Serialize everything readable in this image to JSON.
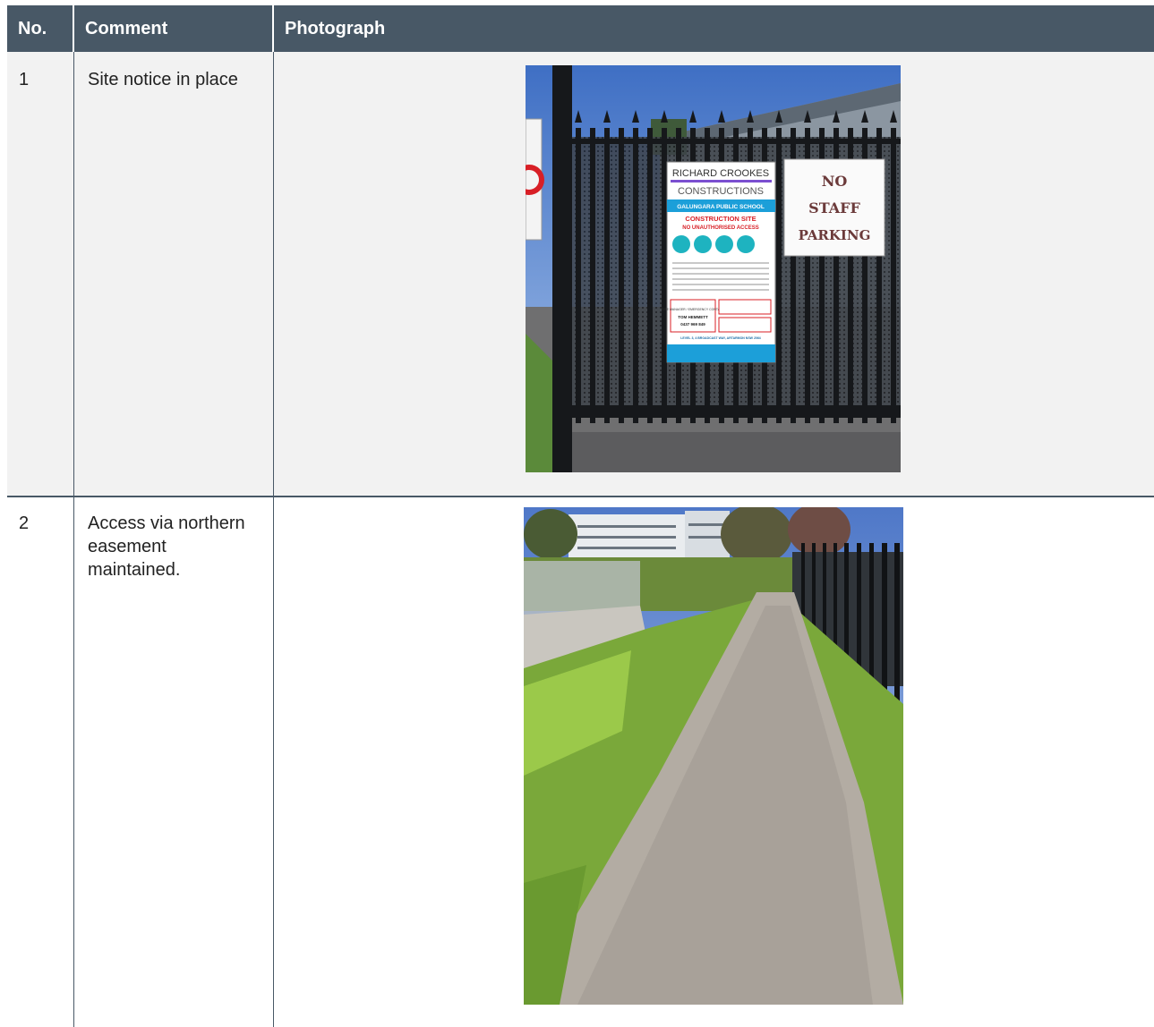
{
  "table": {
    "headers": {
      "no": "No.",
      "comment": "Comment",
      "photograph": "Photograph"
    },
    "rows": [
      {
        "no": "1",
        "comment": "Site notice in place",
        "sign": {
          "company_line1": "RICHARD CROOKES",
          "company_line2": "CONSTRUCTIONS",
          "school": "GALUNGARA PUBLIC SCHOOL",
          "warning1": "CONSTRUCTION SITE",
          "warning2": "NO UNAUTHORISED ACCESS",
          "manager_label": "SITE MANAGER / EMERGENCY CONTACT",
          "manager_name": "TOM HEMMETT",
          "manager_phone": "0437 969 849",
          "address": "LEVEL 3, 4 BROADCAST WAY, ARTARMON NSW 2064"
        },
        "parking_sign": {
          "line1": "NO",
          "line2": "STAFF",
          "line3": "PARKING"
        }
      },
      {
        "no": "2",
        "comment": "Access via northern easement maintained."
      }
    ]
  },
  "colors": {
    "header_bg": "#485866",
    "row_alt_bg": "#f2f2f2"
  }
}
